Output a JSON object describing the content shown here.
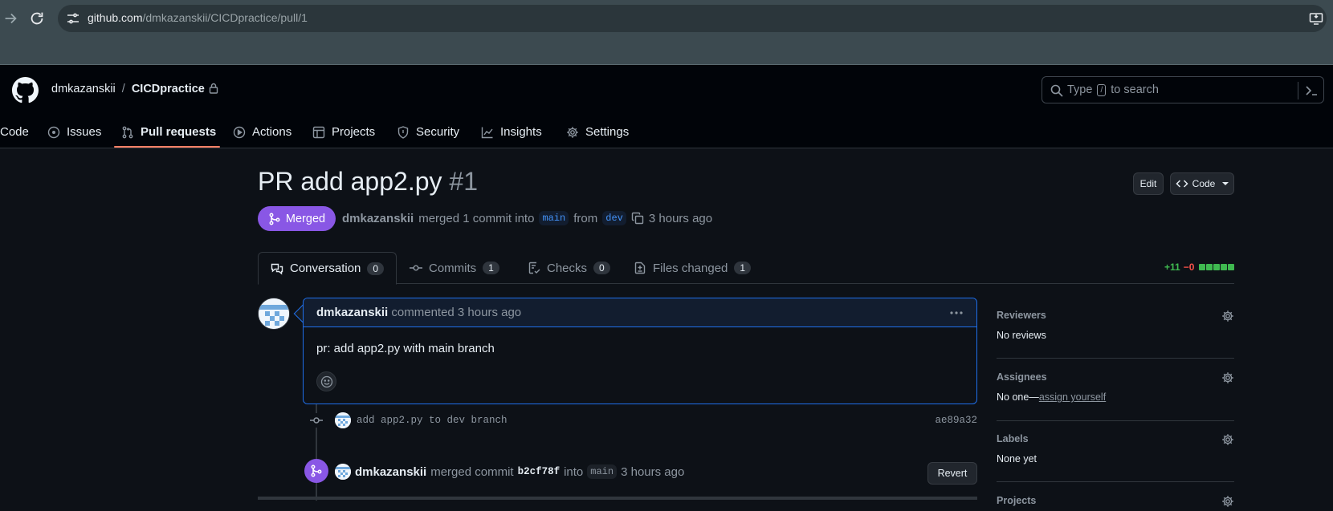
{
  "browser": {
    "url_host": "github.com",
    "url_path": "/dmkazanskii/CICDpractice/pull/1"
  },
  "repo": {
    "owner": "dmkazanskii",
    "separator": "/",
    "name": "CICDpractice"
  },
  "search": {
    "prefix": "Type",
    "key": "/",
    "suffix": "to search"
  },
  "repo_tabs": [
    {
      "label": "Code",
      "icon": "code-icon"
    },
    {
      "label": "Issues",
      "icon": "issue-icon"
    },
    {
      "label": "Pull requests",
      "icon": "pull-request-icon",
      "active": true
    },
    {
      "label": "Actions",
      "icon": "play-icon"
    },
    {
      "label": "Projects",
      "icon": "table-icon"
    },
    {
      "label": "Security",
      "icon": "shield-icon"
    },
    {
      "label": "Insights",
      "icon": "graph-icon"
    },
    {
      "label": "Settings",
      "icon": "gear-icon"
    }
  ],
  "pr": {
    "title": "PR add app2.py",
    "number": "#1",
    "state": "Merged",
    "author": "dmkazanskii",
    "merge_text": "merged 1 commit into",
    "base_branch": "main",
    "from_text": "from",
    "head_branch": "dev",
    "time": "3 hours ago"
  },
  "header_buttons": {
    "edit": "Edit",
    "code": "Code"
  },
  "pr_tabs": [
    {
      "label": "Conversation",
      "count": "0",
      "icon": "conversation-icon",
      "active": true
    },
    {
      "label": "Commits",
      "count": "1",
      "icon": "commit-icon"
    },
    {
      "label": "Checks",
      "count": "0",
      "icon": "checklist-icon"
    },
    {
      "label": "Files changed",
      "count": "1",
      "icon": "file-diff-icon"
    }
  ],
  "diffstat": {
    "additions": "+11",
    "deletions": "−0",
    "added_blocks": 5,
    "color_add": "#3fb950",
    "color_del": "#f85149"
  },
  "comment": {
    "author": "dmkazanskii",
    "action": "commented 3 hours ago",
    "body": "pr: add app2.py with main branch"
  },
  "commit": {
    "message": "add app2.py to dev branch",
    "sha": "ae89a32"
  },
  "merge_event": {
    "author": "dmkazanskii",
    "action": "merged commit",
    "sha": "b2cf78f",
    "into": "into",
    "branch": "main",
    "time": "3 hours ago",
    "revert_label": "Revert"
  },
  "sidebar": {
    "reviewers": {
      "title": "Reviewers",
      "value": "No reviews"
    },
    "assignees": {
      "title": "Assignees",
      "value": "No one—",
      "link": "assign yourself"
    },
    "labels": {
      "title": "Labels",
      "value": "None yet"
    },
    "projects": {
      "title": "Projects"
    }
  },
  "colors": {
    "background": "#0d1117",
    "header": "#010409",
    "merged": "#8957e5",
    "accent_underline": "#f78166",
    "link_blue": "#4493f8"
  }
}
